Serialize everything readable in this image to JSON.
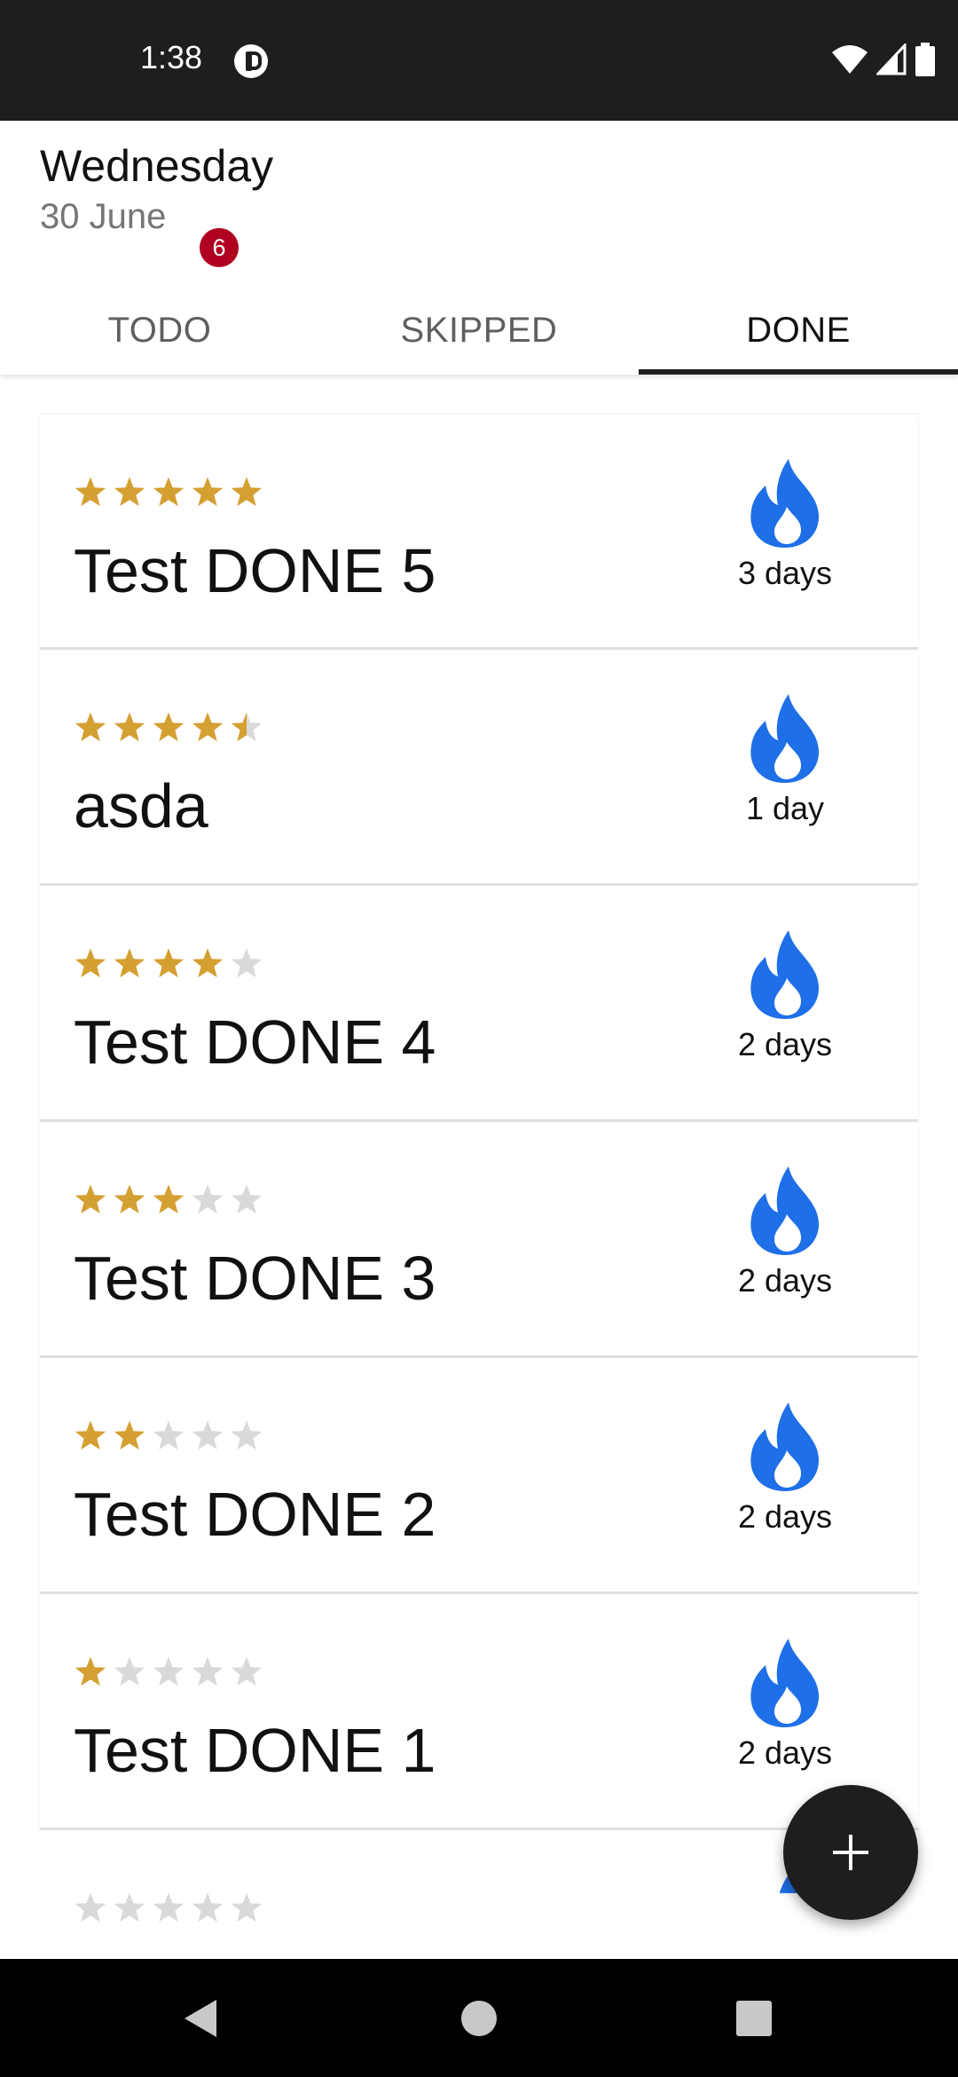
{
  "status_bar": {
    "time": "1:38"
  },
  "header": {
    "day_name": "Wednesday",
    "date": "30 June"
  },
  "tabs": [
    {
      "label": "TODO",
      "badge": "6",
      "active": false
    },
    {
      "label": "SKIPPED",
      "active": false
    },
    {
      "label": "DONE",
      "active": true
    }
  ],
  "items": [
    {
      "title": "Test DONE 5",
      "rating": 5,
      "streak": "3 days"
    },
    {
      "title": "asda",
      "rating": 4.5,
      "streak": "1 day"
    },
    {
      "title": "Test DONE 4",
      "rating": 4,
      "streak": "2 days"
    },
    {
      "title": "Test DONE 3",
      "rating": 3,
      "streak": "2 days"
    },
    {
      "title": "Test DONE 2",
      "rating": 2,
      "streak": "2 days"
    },
    {
      "title": "Test DONE 1",
      "rating": 1,
      "streak": "2 days"
    },
    {
      "title": "",
      "rating": 0,
      "streak": ""
    }
  ],
  "colors": {
    "star_filled": "#D4A032",
    "star_empty": "#D9D9D9",
    "flame": "#1E6FE8",
    "badge": "#B00020",
    "bars": "#1E1E1E"
  },
  "icons": {
    "fab": "plus-icon",
    "streak": "flame-icon",
    "nav": [
      "back-icon",
      "home-icon",
      "recents-icon"
    ]
  }
}
